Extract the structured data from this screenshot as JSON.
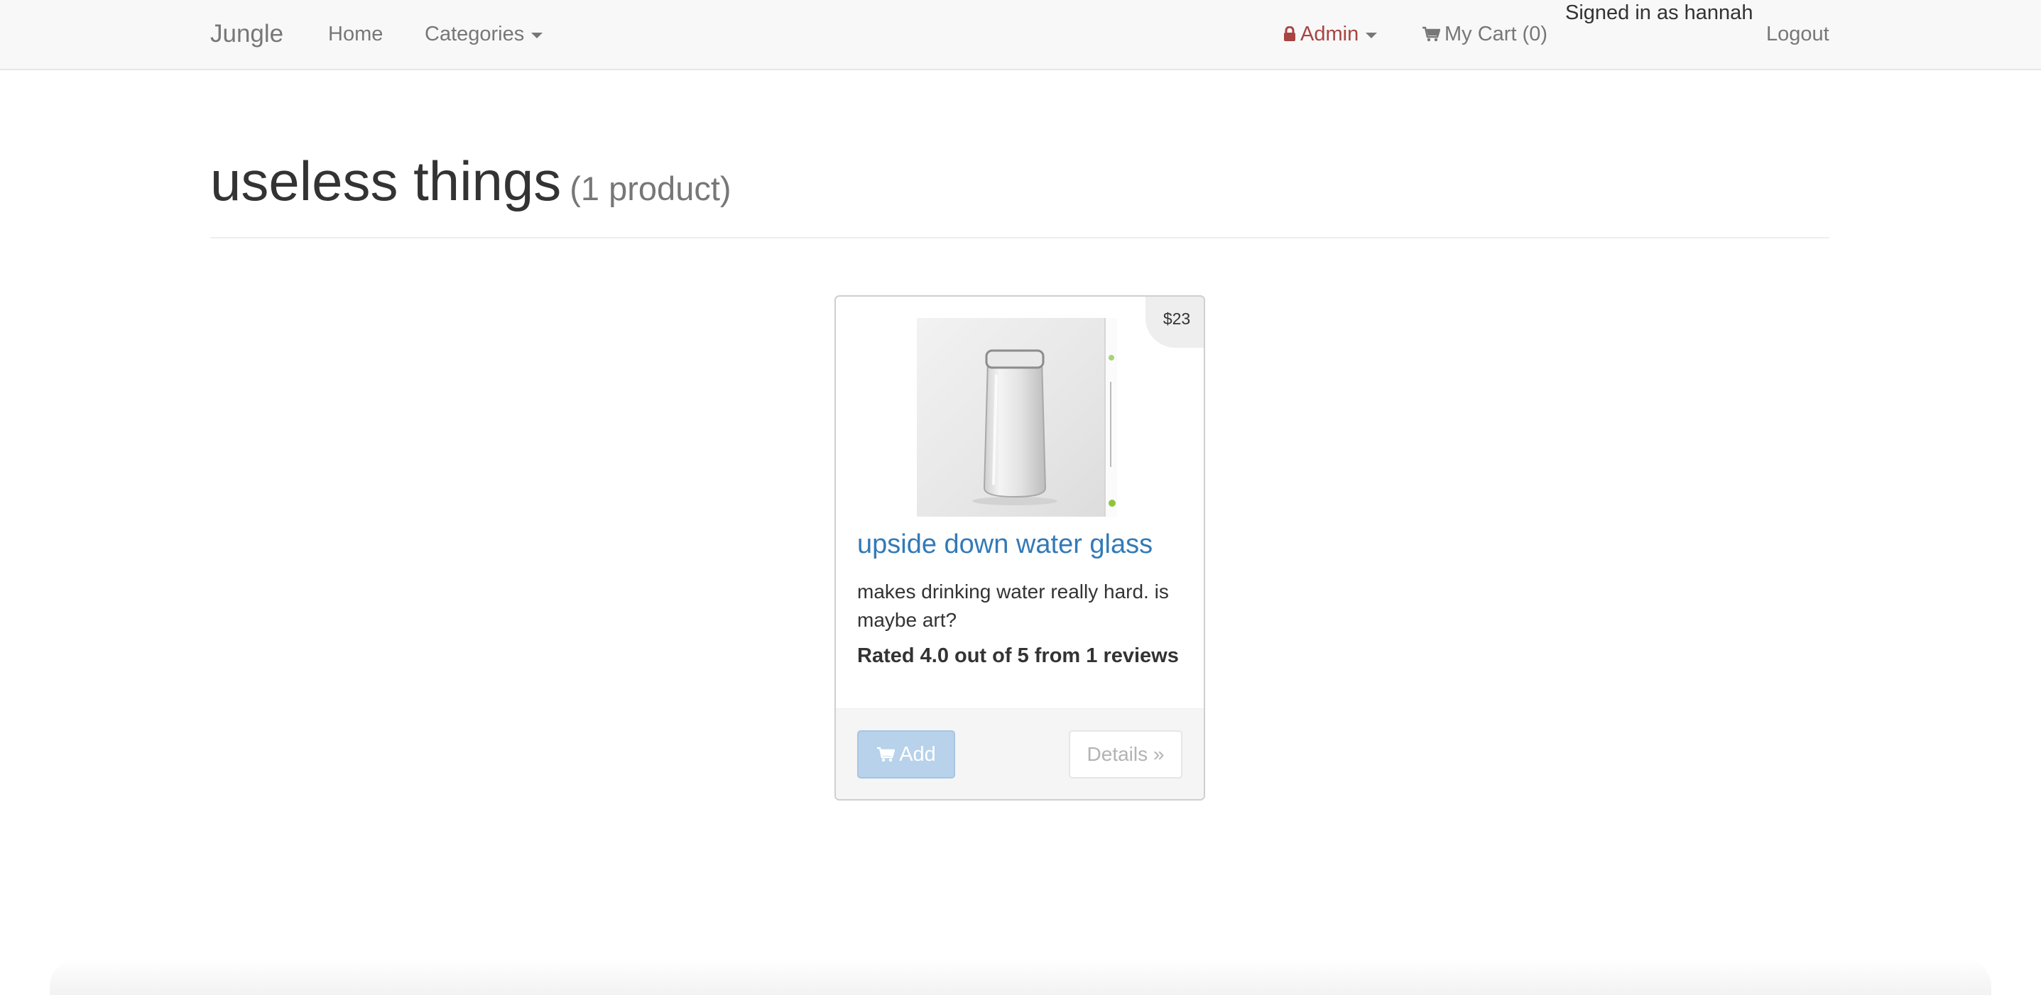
{
  "navbar": {
    "brand": "Jungle",
    "home": "Home",
    "categories": "Categories",
    "admin": "Admin",
    "cart": "My Cart (0)",
    "signed_in": "Signed in as hannah",
    "logout": "Logout"
  },
  "page": {
    "title": "useless things",
    "count": "(1 product)"
  },
  "product": {
    "price": "$23",
    "name": "upside down water glass",
    "description": "makes drinking water really hard. is maybe art?",
    "rating": "Rated 4.0 out of 5 from 1 reviews",
    "add_label": "Add",
    "details_label": "Details »"
  },
  "colors": {
    "navbar_bg": "#f8f8f8",
    "link": "#337ab7",
    "admin": "#a94442",
    "add_button": "#b7d2ea"
  },
  "icons": {
    "admin": "lock-icon",
    "cart": "shopping-cart-icon"
  }
}
